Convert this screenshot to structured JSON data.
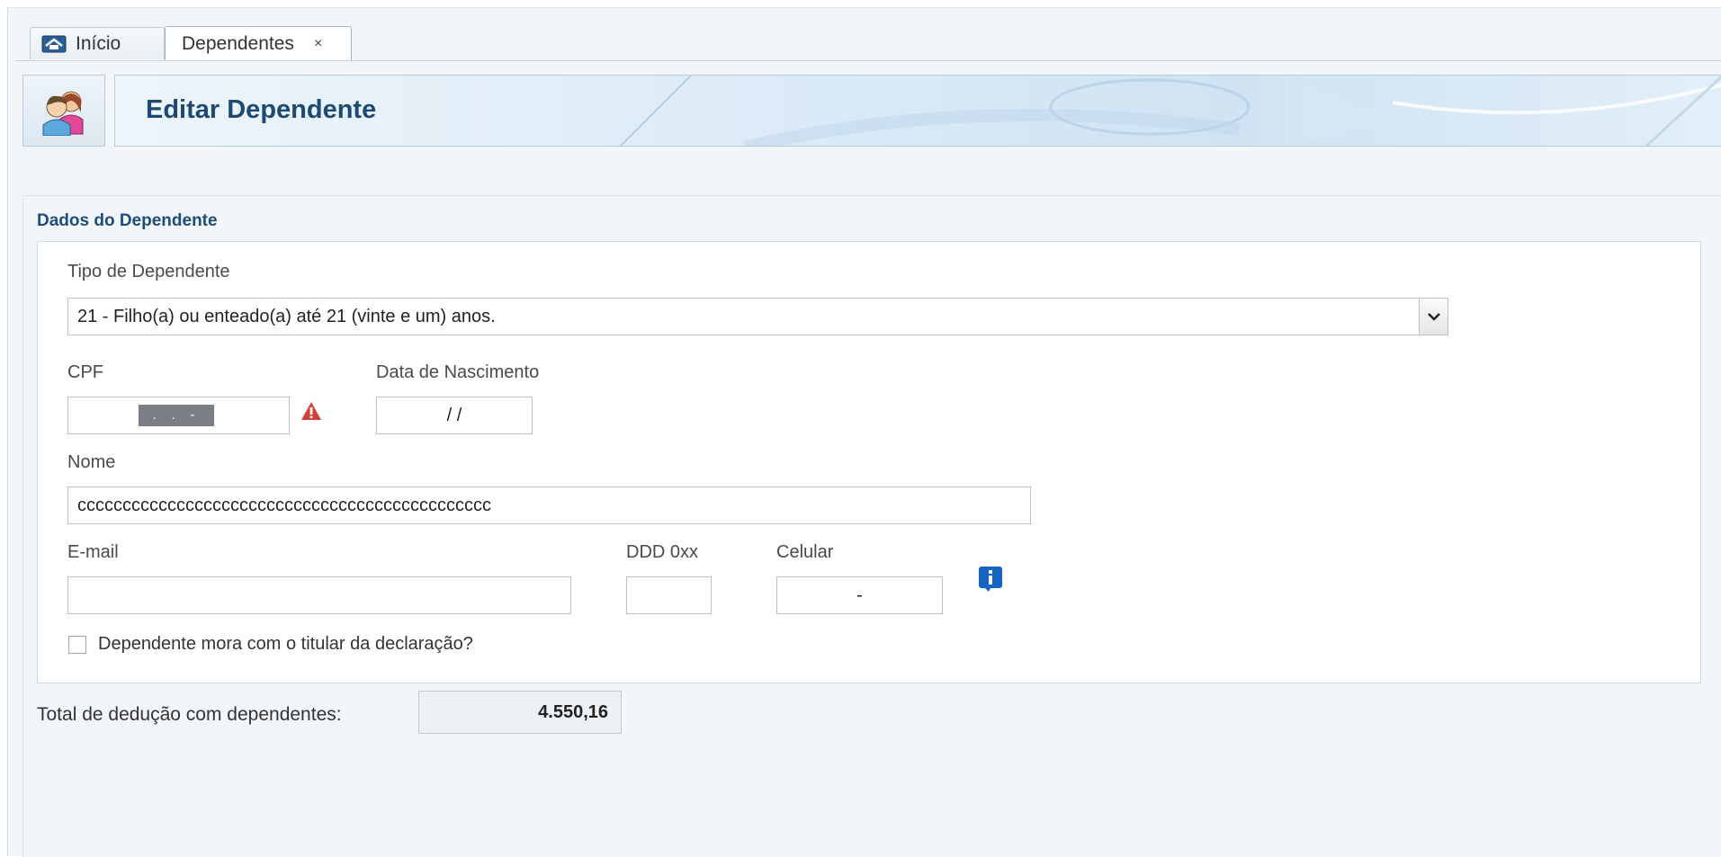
{
  "tabs": [
    {
      "label": "Início",
      "icon": "home-icon"
    },
    {
      "label": "Dependentes",
      "close": "×"
    }
  ],
  "header": {
    "title": "Editar Dependente",
    "icon": "dependents-icon"
  },
  "section": {
    "title": "Dados do Dependente"
  },
  "form": {
    "tipo_label": "Tipo de Dependente",
    "tipo_value": "21 - Filho(a) ou enteado(a) até 21 (vinte e um) anos.",
    "cpf_label": "CPF",
    "cpf_mask": ". . -",
    "data_label": "Data de Nascimento",
    "data_value": "/ /",
    "nome_label": "Nome",
    "nome_value": "cccccccccccccccccccccccccccccccccccccccccccccc",
    "email_label": "E-mail",
    "email_value": "",
    "ddd_label": "DDD 0xx",
    "ddd_value": "",
    "celular_label": "Celular",
    "celular_value": "-",
    "checkbox_label": "Dependente mora com o titular da declaração?"
  },
  "total": {
    "label": "Total de dedução com dependentes:",
    "value": "4.550,16"
  },
  "colors": {
    "accent": "#1c4a72",
    "warning": "#d43f3a",
    "info": "#1565c0"
  }
}
